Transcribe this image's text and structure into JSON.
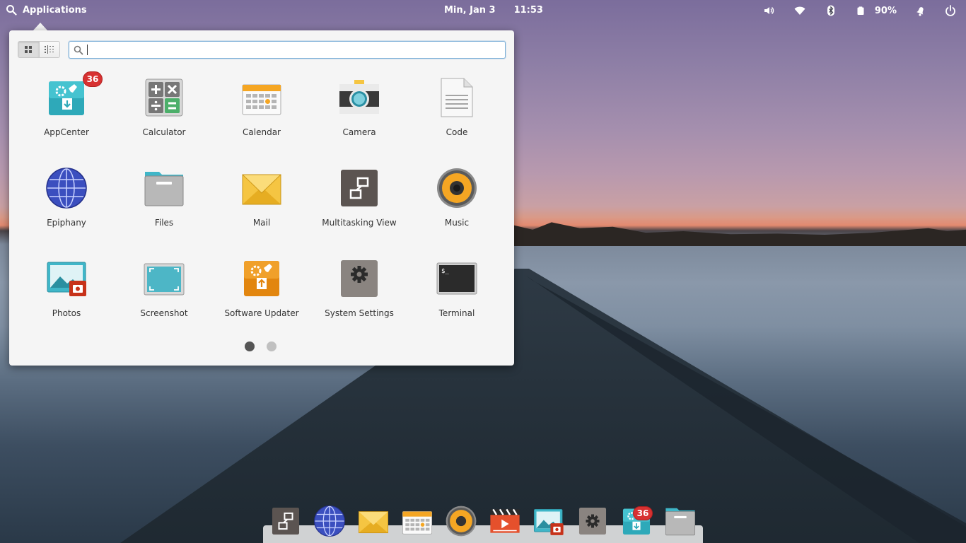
{
  "panel": {
    "applications_label": "Applications",
    "date": "Min, Jan 3",
    "time": "11:53",
    "battery_percent": "90%",
    "indicator_icons": [
      "volume-icon",
      "wifi-icon",
      "bluetooth-icon",
      "battery-icon",
      "notifications-icon",
      "power-icon"
    ]
  },
  "launcher": {
    "search_value": "",
    "view_modes": [
      "grid",
      "category"
    ],
    "active_view": "grid",
    "apps": [
      {
        "label": "AppCenter",
        "icon": "appcenter-icon",
        "badge": "36"
      },
      {
        "label": "Calculator",
        "icon": "calculator-icon"
      },
      {
        "label": "Calendar",
        "icon": "calendar-icon"
      },
      {
        "label": "Camera",
        "icon": "camera-icon"
      },
      {
        "label": "Code",
        "icon": "code-icon"
      },
      {
        "label": "Epiphany",
        "icon": "web-browser-icon"
      },
      {
        "label": "Files",
        "icon": "files-icon"
      },
      {
        "label": "Mail",
        "icon": "mail-icon"
      },
      {
        "label": "Multitasking View",
        "icon": "multitasking-icon"
      },
      {
        "label": "Music",
        "icon": "music-icon"
      },
      {
        "label": "Photos",
        "icon": "photos-icon"
      },
      {
        "label": "Screenshot",
        "icon": "screenshot-icon"
      },
      {
        "label": "Software Updater",
        "icon": "software-updater-icon"
      },
      {
        "label": "System Settings",
        "icon": "settings-icon"
      },
      {
        "label": "Terminal",
        "icon": "terminal-icon"
      }
    ],
    "pages": 2,
    "current_page": 1
  },
  "dock": {
    "items": [
      "multitasking-icon",
      "web-browser-icon",
      "mail-icon",
      "calendar-icon",
      "music-icon",
      "videos-icon",
      "photos-icon",
      "settings-icon",
      "appcenter-icon",
      "files-icon"
    ],
    "appcenter_badge": "36"
  },
  "colors": {
    "badge": "#d73131",
    "accent_teal": "#3fb6c8",
    "search_focus": "#7fb1d8"
  }
}
